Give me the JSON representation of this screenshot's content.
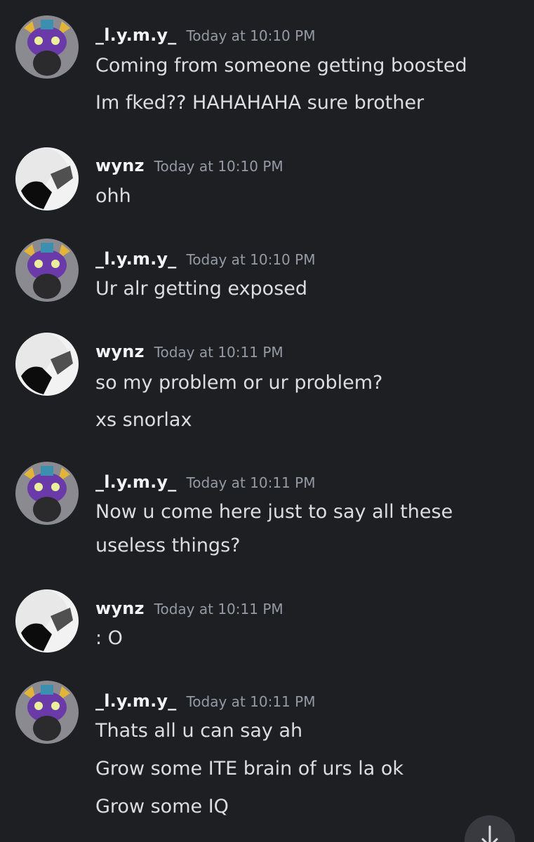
{
  "messages": [
    {
      "author": "_l.y.m.y_",
      "timestamp": "Today at 10:10 PM",
      "avatar": "lymy-avatar",
      "lines": [
        "Coming from someone getting boosted",
        "Im fked?? HAHAHAHA sure brother"
      ]
    },
    {
      "author": "wynz",
      "timestamp": "Today at 10:10 PM",
      "avatar": "wynz-avatar",
      "lines": [
        "ohh"
      ]
    },
    {
      "author": "_l.y.m.y_",
      "timestamp": "Today at 10:10 PM",
      "avatar": "lymy-avatar",
      "lines": [
        "Ur alr getting exposed"
      ]
    },
    {
      "author": "wynz",
      "timestamp": "Today at 10:11 PM",
      "avatar": "wynz-avatar",
      "lines": [
        "so my problem or ur problem?",
        "xs snorlax"
      ]
    },
    {
      "author": "_l.y.m.y_",
      "timestamp": "Today at 10:11 PM",
      "avatar": "lymy-avatar",
      "lines": [
        "Now u come here just to say all these",
        "useless things?"
      ]
    },
    {
      "author": "wynz",
      "timestamp": "Today at 10:11 PM",
      "avatar": "wynz-avatar",
      "lines": [
        ": O"
      ]
    },
    {
      "author": "_l.y.m.y_",
      "timestamp": "Today at 10:11 PM",
      "avatar": "lymy-avatar",
      "lines": [
        "Thats all u can say ah",
        "Grow some ITE brain of urs la ok",
        "Grow some IQ"
      ]
    }
  ],
  "scroll_button": {
    "icon": "arrow-down-icon"
  },
  "colors": {
    "background": "#1e1f22",
    "author": "#f2f3f5",
    "timestamp": "#949ba4",
    "message_text": "#dbdee1"
  }
}
